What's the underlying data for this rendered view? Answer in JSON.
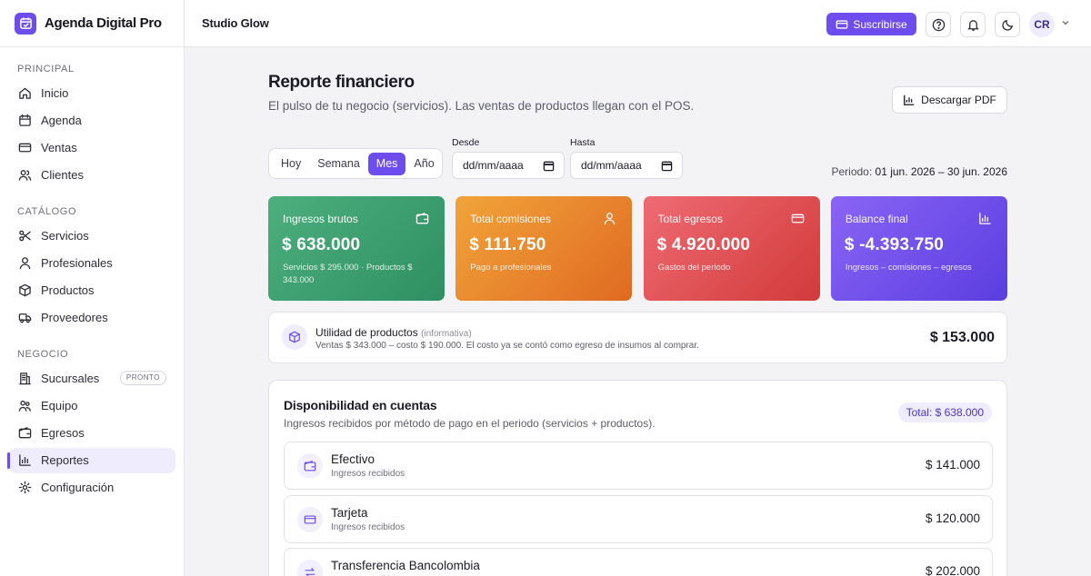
{
  "brand": {
    "name": "Agenda Digital Pro"
  },
  "sidebar": {
    "sections": [
      {
        "title": "PRINCIPAL",
        "items": [
          {
            "label": "Inicio",
            "icon": "home-icon"
          },
          {
            "label": "Agenda",
            "icon": "calendar-icon"
          },
          {
            "label": "Ventas",
            "icon": "credit-card-icon"
          },
          {
            "label": "Clientes",
            "icon": "users-icon"
          }
        ]
      },
      {
        "title": "CATÁLOGO",
        "items": [
          {
            "label": "Servicios",
            "icon": "scissors-icon"
          },
          {
            "label": "Profesionales",
            "icon": "user-icon"
          },
          {
            "label": "Productos",
            "icon": "box-icon"
          },
          {
            "label": "Proveedores",
            "icon": "truck-icon"
          }
        ]
      },
      {
        "title": "NEGOCIO",
        "items": [
          {
            "label": "Sucursales",
            "icon": "building-icon",
            "badge": "PRONTO"
          },
          {
            "label": "Equipo",
            "icon": "team-icon"
          },
          {
            "label": "Egresos",
            "icon": "wallet-icon"
          },
          {
            "label": "Reportes",
            "icon": "bar-chart-icon",
            "active": true
          },
          {
            "label": "Configuración",
            "icon": "gear-icon"
          }
        ]
      }
    ]
  },
  "topbar": {
    "studio": "Studio Glow",
    "subscribe_label": "Suscribirse",
    "avatar_initials": "CR"
  },
  "page": {
    "title": "Reporte financiero",
    "subtitle": "El pulso de tu negocio (servicios). Las ventas de productos llegan con el POS.",
    "pdf_label": "Descargar PDF"
  },
  "filters": {
    "ranges": [
      "Hoy",
      "Semana",
      "Mes",
      "Año"
    ],
    "selected": "Mes",
    "from_label": "Desde",
    "to_label": "Hasta",
    "from_value": "dd/mm/aaaa",
    "to_value": "dd/mm/aaaa",
    "period_label": "Periodo:",
    "period_value": "01 jun. 2026 – 30 jun. 2026"
  },
  "cards": [
    {
      "label": "Ingresos brutos",
      "value": "$ 638.000",
      "sub": "Servicios $ 295.000 · Productos $ 343.000",
      "icon": "wallet-icon",
      "color_from": "#4caf7d",
      "color_to": "#2f8f62"
    },
    {
      "label": "Total comisiones",
      "value": "$ 111.750",
      "sub": "Pago a profesionales",
      "icon": "user-icon",
      "color_from": "#f1a43a",
      "color_to": "#e06a22"
    },
    {
      "label": "Total egresos",
      "value": "$ 4.920.000",
      "sub": "Gastos del periodo",
      "icon": "credit-card-icon",
      "color_from": "#ee6b73",
      "color_to": "#d23a3a"
    },
    {
      "label": "Balance final",
      "value": "$ -4.393.750",
      "sub": "Ingresos – comisiones – egresos",
      "icon": "bar-chart-icon",
      "color_from": "#8a64f5",
      "color_to": "#5a3ee0"
    }
  ],
  "utilidad": {
    "title": "Utilidad de productos",
    "note": "(informativa)",
    "detail": "Ventas $ 343.000 – costo $ 190.000. El costo ya se contó como egreso de insumos al comprar.",
    "value": "$ 153.000"
  },
  "disponibilidad": {
    "title": "Disponibilidad en cuentas",
    "subtitle": "Ingresos recibidos por método de pago en el periodo (servicios + productos).",
    "total": "Total: $ 638.000",
    "rows": [
      {
        "name": "Efectivo",
        "sub": "Ingresos recibidos",
        "value": "$ 141.000",
        "icon": "wallet-icon"
      },
      {
        "name": "Tarjeta",
        "sub": "Ingresos recibidos",
        "value": "$ 120.000",
        "icon": "credit-card-icon"
      },
      {
        "name": "Transferencia Bancolombia",
        "sub": "Ingresos recibidos",
        "value": "$ 202.000",
        "icon": "transfer-icon"
      }
    ]
  },
  "colors": {
    "accent": "#6d4ded"
  }
}
